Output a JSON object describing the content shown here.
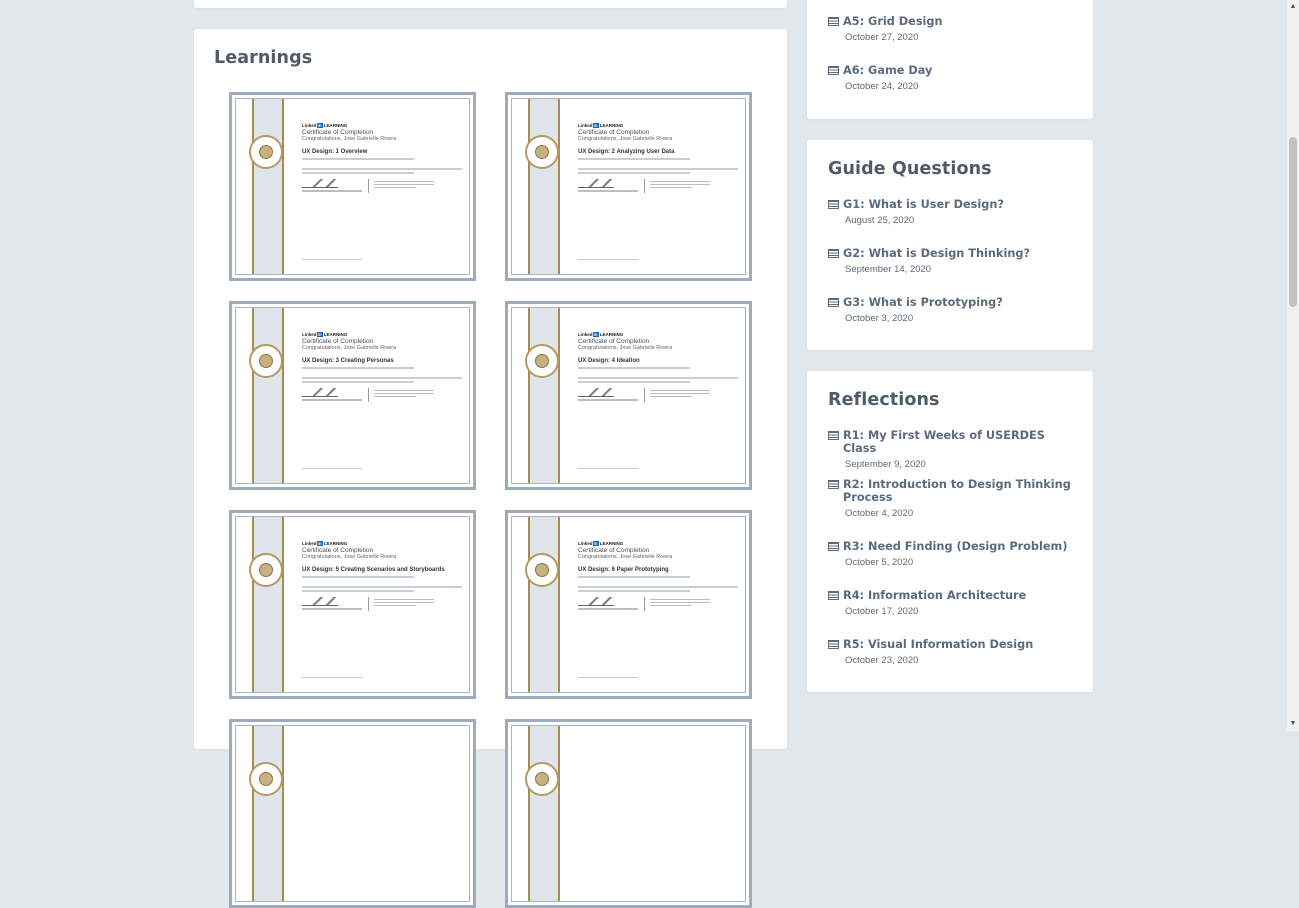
{
  "learnings": {
    "title": "Learnings",
    "certificates": [
      {
        "course": "UX Design: 1 Overview"
      },
      {
        "course": "UX Design: 2 Analyzing User Data"
      },
      {
        "course": "UX Design: 3 Creating Personas"
      },
      {
        "course": "UX Design: 4 Ideation"
      },
      {
        "course": "UX Design: 5 Creating Scenarios and Storyboards"
      },
      {
        "course": "UX Design: 6 Paper Prototyping"
      }
    ],
    "certificate_common": {
      "brand": "Linked",
      "brand_in": "in",
      "brand_suffix": " LEARNING",
      "heading": "Certificate of Completion",
      "congrats": "Congratulations, Jose Gabrielle Rivera"
    }
  },
  "assignments": {
    "items": [
      {
        "title": "A5: Grid Design",
        "date": "October 27, 2020"
      },
      {
        "title": "A6: Game Day",
        "date": "October 24, 2020"
      }
    ]
  },
  "guide_questions": {
    "title": "Guide Questions",
    "items": [
      {
        "title": "G1: What is User Design?",
        "date": "August 25, 2020"
      },
      {
        "title": "G2: What is Design Thinking?",
        "date": "September 14, 2020"
      },
      {
        "title": "G3: What is Prototyping?",
        "date": "October 3, 2020"
      }
    ]
  },
  "reflections": {
    "title": "Reflections",
    "items": [
      {
        "title": "R1: My First Weeks of USERDES Class",
        "date": "September 9, 2020"
      },
      {
        "title": "R2: Introduction to Design Thinking Process",
        "date": "October 4, 2020"
      },
      {
        "title": "R3: Need Finding (Design Problem)",
        "date": "October 5, 2020"
      },
      {
        "title": "R4: Information Architecture",
        "date": "October 17, 2020"
      },
      {
        "title": "R5: Visual Information Design",
        "date": "October 23, 2020"
      }
    ]
  },
  "scrollbar": {
    "up_glyph": "▲",
    "down_glyph": "▼"
  }
}
